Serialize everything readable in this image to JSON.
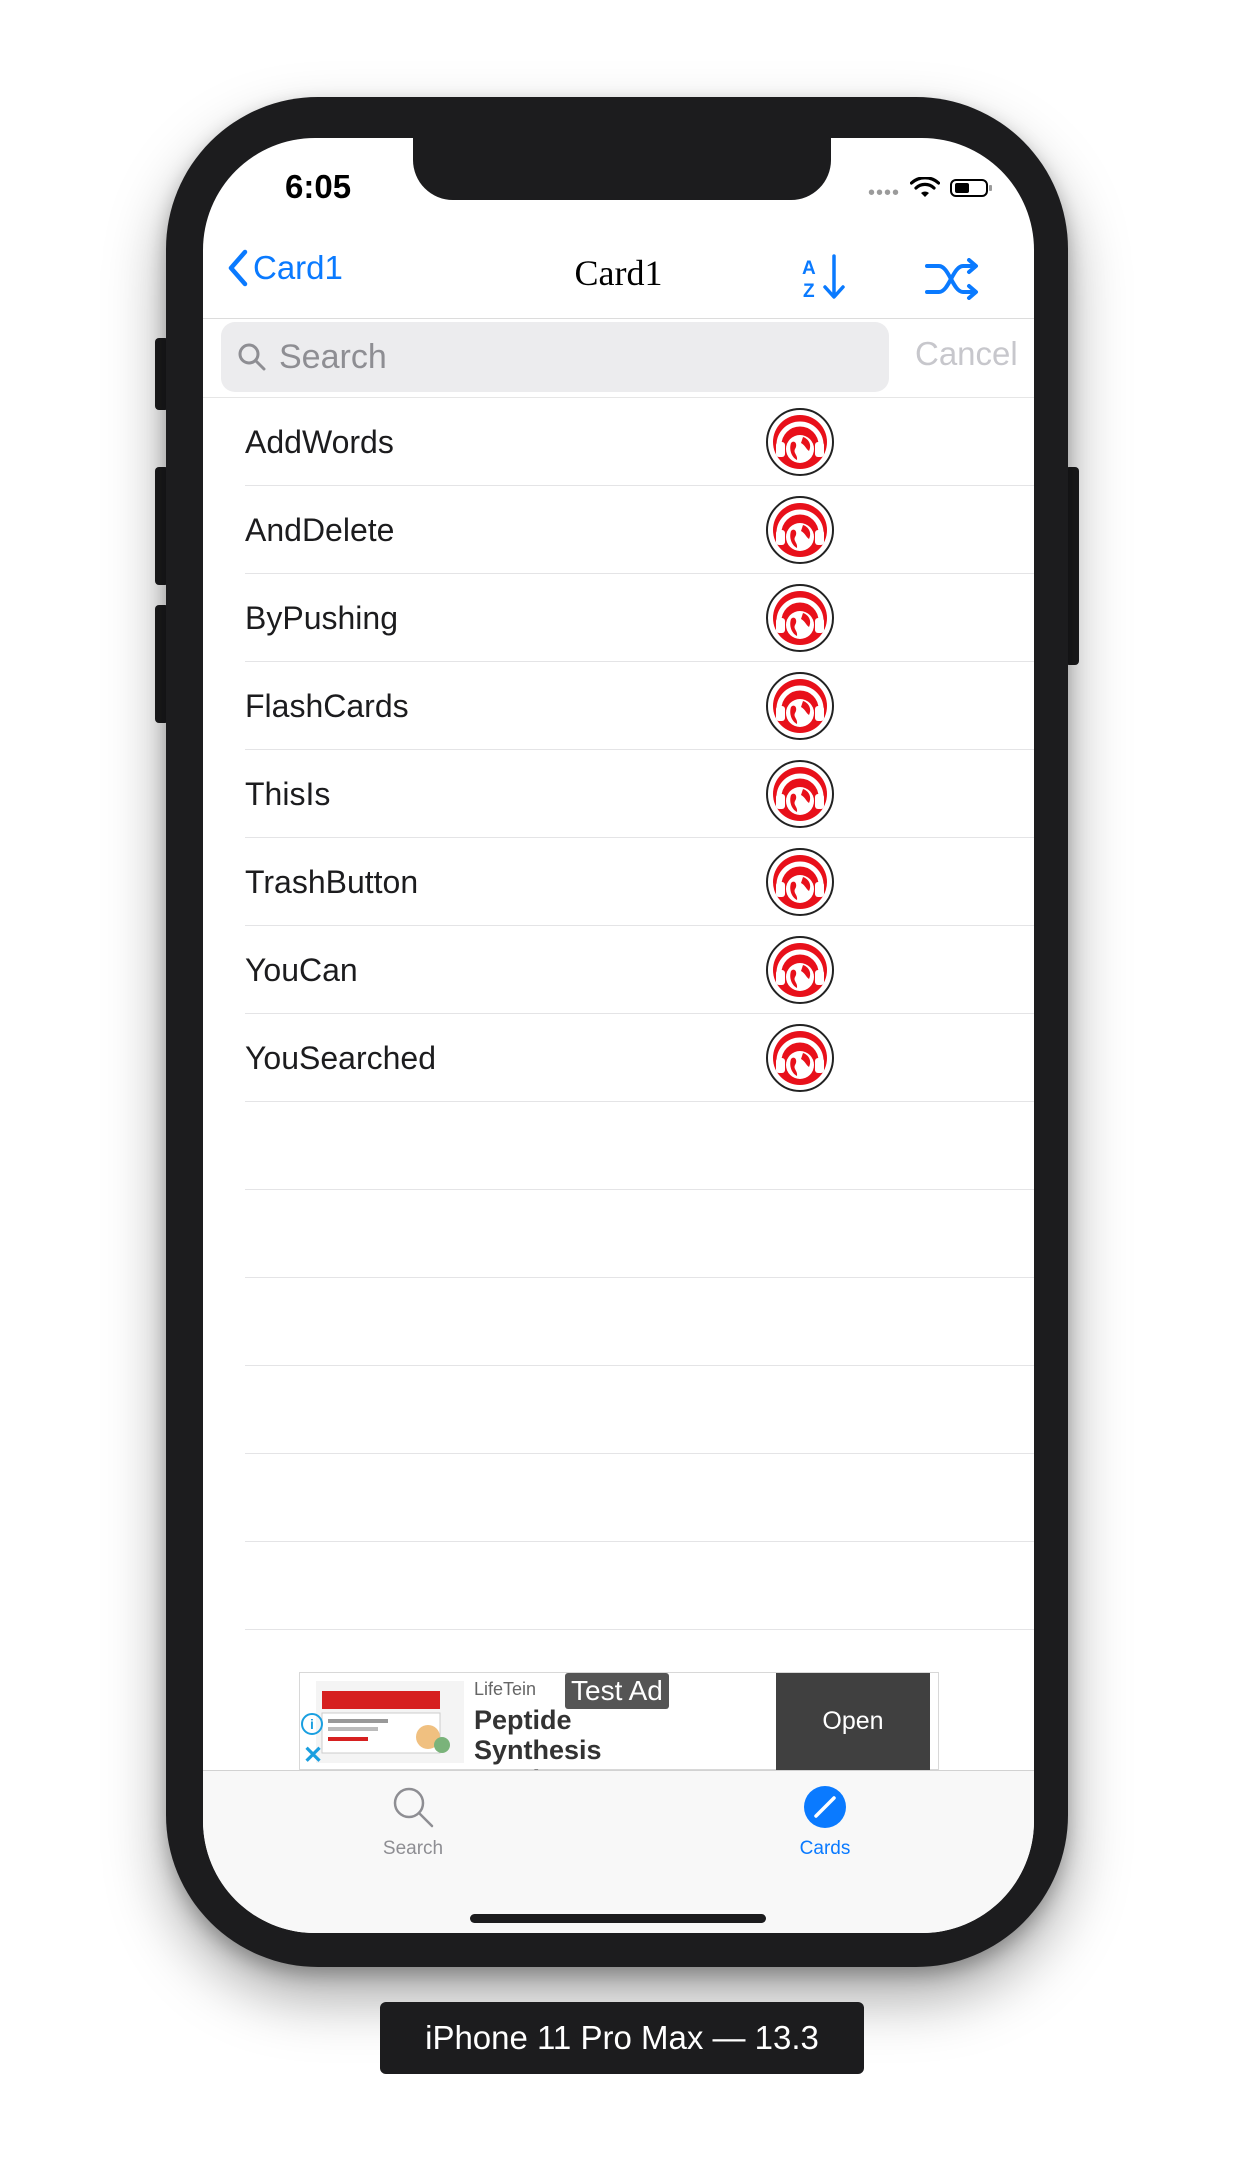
{
  "status_bar": {
    "time": "6:05"
  },
  "nav": {
    "back_label": "Card1",
    "title": "Card1",
    "sort_icon": "sort-az-icon",
    "shuffle_icon": "shuffle-icon",
    "accent_color": "#0a7aff"
  },
  "search": {
    "placeholder": "Search",
    "value": "",
    "cancel_label": "Cancel"
  },
  "list": {
    "items": [
      {
        "label": "AddWords"
      },
      {
        "label": "AndDelete"
      },
      {
        "label": "ByPushing"
      },
      {
        "label": "FlashCards"
      },
      {
        "label": "ThisIs"
      },
      {
        "label": "TrashButton"
      },
      {
        "label": "YouCan"
      },
      {
        "label": "YouSearched"
      }
    ],
    "item_icon": "audio-globe-icon",
    "icon_color": "#e8101a"
  },
  "ad": {
    "sponsor": "LifeTein",
    "headline": "Peptide Synthesis Service",
    "badge": "Test Ad",
    "cta": "Open"
  },
  "tabbar": {
    "tabs": [
      {
        "label": "Search",
        "icon": "search-icon",
        "active": false
      },
      {
        "label": "Cards",
        "icon": "compass-icon",
        "active": true
      }
    ],
    "active_color": "#0a7aff",
    "inactive_color": "#8e8e93"
  },
  "device_label": "iPhone 11 Pro Max — 13.3"
}
